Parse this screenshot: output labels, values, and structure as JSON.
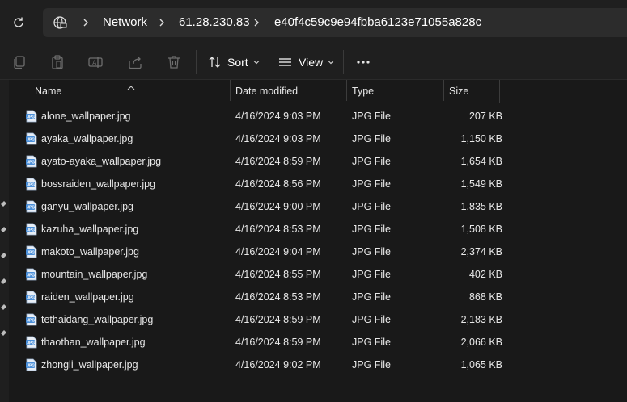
{
  "address": {
    "crumbs": [
      "Network",
      "61.28.230.83",
      "e40f4c59c9e94fbba6123e71055a828c"
    ]
  },
  "toolbar": {
    "sort_label": "Sort",
    "view_label": "View",
    "more_label": "•••"
  },
  "columns": {
    "name": "Name",
    "date": "Date modified",
    "type": "Type",
    "size": "Size"
  },
  "files": [
    {
      "name": "alone_wallpaper.jpg",
      "date": "4/16/2024 9:03 PM",
      "type": "JPG File",
      "size": "207 KB"
    },
    {
      "name": "ayaka_wallpaper.jpg",
      "date": "4/16/2024 9:03 PM",
      "type": "JPG File",
      "size": "1,150 KB"
    },
    {
      "name": "ayato-ayaka_wallpaper.jpg",
      "date": "4/16/2024 8:59 PM",
      "type": "JPG File",
      "size": "1,654 KB"
    },
    {
      "name": "bossraiden_wallpaper.jpg",
      "date": "4/16/2024 8:56 PM",
      "type": "JPG File",
      "size": "1,549 KB"
    },
    {
      "name": "ganyu_wallpaper.jpg",
      "date": "4/16/2024 9:00 PM",
      "type": "JPG File",
      "size": "1,835 KB"
    },
    {
      "name": "kazuha_wallpaper.jpg",
      "date": "4/16/2024 8:53 PM",
      "type": "JPG File",
      "size": "1,508 KB"
    },
    {
      "name": "makoto_wallpaper.jpg",
      "date": "4/16/2024 9:04 PM",
      "type": "JPG File",
      "size": "2,374 KB"
    },
    {
      "name": "mountain_wallpaper.jpg",
      "date": "4/16/2024 8:55 PM",
      "type": "JPG File",
      "size": "402 KB"
    },
    {
      "name": "raiden_wallpaper.jpg",
      "date": "4/16/2024 8:53 PM",
      "type": "JPG File",
      "size": "868 KB"
    },
    {
      "name": "tethaidang_wallpaper.jpg",
      "date": "4/16/2024 8:59 PM",
      "type": "JPG File",
      "size": "2,183 KB"
    },
    {
      "name": "thaothan_wallpaper.jpg",
      "date": "4/16/2024 8:59 PM",
      "type": "JPG File",
      "size": "2,066 KB"
    },
    {
      "name": "zhongli_wallpaper.jpg",
      "date": "4/16/2024 9:02 PM",
      "type": "JPG File",
      "size": "1,065 KB"
    }
  ],
  "icons": {
    "file": "jpg-file-icon",
    "toolbar": [
      "copy-icon",
      "paste-icon",
      "rename-icon",
      "share-icon",
      "delete-icon",
      "sort-icon",
      "view-icon",
      "more-icon"
    ]
  },
  "colors": {
    "background": "#191919",
    "bar": "#1f1f1f",
    "address": "#2c2c2c",
    "file_icon_blue": "#4a8fd9"
  }
}
